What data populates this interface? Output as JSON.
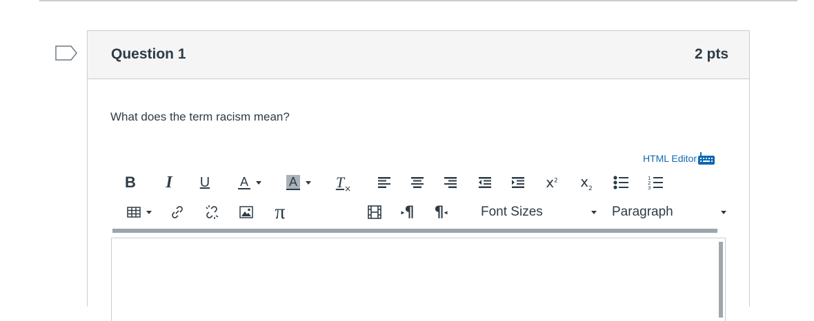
{
  "question": {
    "title": "Question 1",
    "points": "2 pts",
    "text": "What does the term racism mean?"
  },
  "editor": {
    "html_editor_label": "HTML Editor",
    "toolbar_row1": [
      "bold-icon",
      "italic-icon",
      "underline-icon",
      "text-color-icon",
      "background-color-icon",
      "clear-formatting-icon",
      "align-left-icon",
      "align-center-icon",
      "align-right-icon",
      "outdent-icon",
      "indent-icon",
      "superscript-icon",
      "subscript-icon",
      "bullet-list-icon",
      "numbered-list-icon"
    ],
    "toolbar_row2": [
      "table-icon",
      "link-icon",
      "unlink-icon",
      "image-icon",
      "math-pi-icon",
      "media-icon",
      "ltr-paragraph-icon",
      "rtl-paragraph-icon"
    ],
    "font_sizes_label": "Font Sizes",
    "paragraph_label": "Paragraph",
    "glyphs": {
      "bold": "B",
      "italic": "I",
      "underline": "U",
      "text_color": "A",
      "background_color": "A",
      "clear_formatting": "T",
      "superscript": "x",
      "subscript": "x",
      "pi": "π",
      "ltr": "¶",
      "rtl": "¶"
    }
  },
  "colors": {
    "accent_link": "#0e68b3",
    "text": "#2d3b45",
    "header_bg": "#f5f5f5",
    "border": "#c7cdd1"
  }
}
